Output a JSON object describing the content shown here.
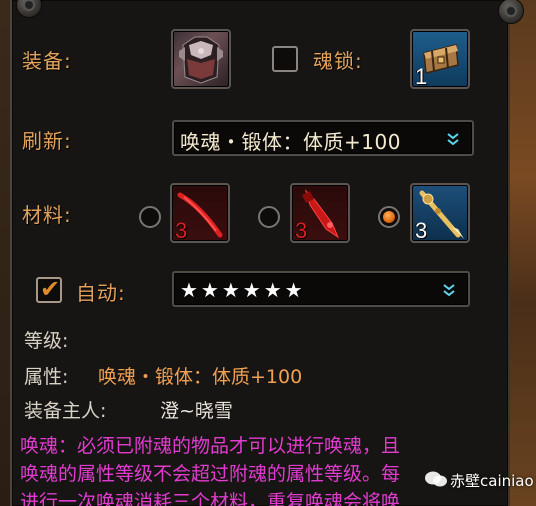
{
  "labels": {
    "equip": "装备:",
    "soul_lock": "魂锁:",
    "refresh": "刷新:",
    "materials": "材料:",
    "auto": "自动:"
  },
  "equip_slot": {
    "icon": "armor-icon"
  },
  "soul_lock_slot": {
    "icon": "treasure-chest-icon",
    "count": "1"
  },
  "refresh_dropdown": {
    "value": "唤魂・锻体：体质+100"
  },
  "materials": [
    {
      "icon": "red-feather-icon",
      "count": "3",
      "selected": false
    },
    {
      "icon": "red-dagger-icon",
      "count": "3",
      "selected": false
    },
    {
      "icon": "golden-staff-icon",
      "count": "3",
      "selected": true
    }
  ],
  "auto_checked": true,
  "auto_dropdown": {
    "value": "★★★★★★"
  },
  "info": {
    "level_label": "等级:",
    "level_value": "",
    "attr_label": "属性:",
    "attr_value": "唤魂・锻体：体质+100",
    "owner_label": "装备主人:",
    "owner_value": "澄~晓雪"
  },
  "description": [
    "唤魂：必须已附魂的物品才可以进行唤魂，且",
    "唤魂的属性等级不会超过附魂的属性等级。每",
    "进行一次唤魂消耗三个材料，重复唤魂会将唤"
  ],
  "watermark": "赤壁cainiao",
  "colors": {
    "label": "#e3a35c",
    "value_orange": "#f0a050",
    "description": "#e23bd0",
    "count_red": "#d42020",
    "count_white": "#ffffff"
  }
}
